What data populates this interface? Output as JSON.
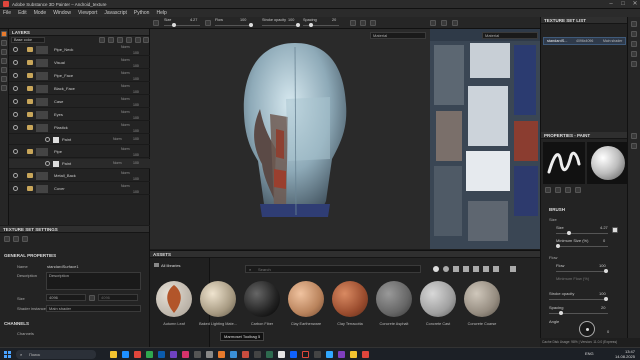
{
  "titlebar": {
    "title": "Adobe Substance 3D Painter – Android_texture",
    "minimize": "–",
    "maximize": "□",
    "close": "✕"
  },
  "menu": [
    "File",
    "Edit",
    "Mode",
    "Window",
    "Viewport",
    "Javascript",
    "Python",
    "Help"
  ],
  "toolbar": {
    "size_label": "Size",
    "size_value": "4.27",
    "flow_label": "Flow",
    "flow_value": "100",
    "stroke_label": "Stroke opacity",
    "stroke_value": "100",
    "spacing_label": "Spacing",
    "spacing_value": "20"
  },
  "layers": {
    "title": "LAYERS",
    "channel": "Base color",
    "rows": [
      {
        "name": "Pipe_Neck",
        "blend": "Norm",
        "opacity": "100"
      },
      {
        "name": "Visual",
        "blend": "Norm",
        "opacity": "100"
      },
      {
        "name": "Pipe_Face",
        "blend": "Norm",
        "opacity": "100"
      },
      {
        "name": "Black_Face",
        "blend": "Norm",
        "opacity": "100"
      },
      {
        "name": "Case",
        "blend": "Norm",
        "opacity": "100"
      },
      {
        "name": "Eyes",
        "blend": "Norm",
        "opacity": "100"
      },
      {
        "name": "Plastick",
        "blend": "Norm",
        "opacity": "100"
      },
      {
        "name": "Paint",
        "blend": "Norm",
        "opacity": "100"
      },
      {
        "name": "Pipe",
        "blend": "Norm",
        "opacity": "100"
      },
      {
        "name": "Paint",
        "blend": "Norm",
        "opacity": "100"
      },
      {
        "name": "Metall_Back",
        "blend": "Norm",
        "opacity": "100"
      },
      {
        "name": "Cover",
        "blend": "Norm",
        "opacity": "100"
      }
    ]
  },
  "texture_set_settings": {
    "title": "TEXTURE SET SETTINGS",
    "general_properties": "GENERAL PROPERTIES",
    "name_label": "Name",
    "name_value": "standardSurface1",
    "description_label": "Description",
    "description_placeholder": "Description",
    "size_label": "Size",
    "size_value": "4096",
    "size_value2": "4096",
    "shader_label": "Shader instance",
    "shader_value": "Main shader",
    "channels": "CHANNELS",
    "channels_sub": "Channels"
  },
  "viewport": {
    "material_select": "Material"
  },
  "uv_view": {
    "material_select": "Material"
  },
  "texture_set_list": {
    "title": "TEXTURE SET LIST",
    "item_name": "standardS...",
    "item_size": "4096x4096",
    "item_shader": "Main shader"
  },
  "properties": {
    "title": "PROPERTIES - PAINT",
    "brush": "BRUSH",
    "size_group": "Size",
    "size_label": "Size",
    "size_value": "4.27",
    "min_size_label": "Minimum Size (%)",
    "min_size_value": "0",
    "flow_group": "Flow",
    "flow_label": "Flow",
    "flow_value": "100",
    "min_flow_label": "Minimum Flow (%)",
    "stroke_label": "Stroke opacity",
    "stroke_value": "100",
    "spacing_label": "Spacing",
    "spacing_value": "20",
    "angle_label": "Angle",
    "angle_value": "0"
  },
  "assets": {
    "title": "ASSETS",
    "library": "All libraries",
    "search_placeholder": "Search",
    "items": [
      {
        "name": "Autumn Leaf"
      },
      {
        "name": "Baked Lighting Mate..."
      },
      {
        "name": "Carbon Fiber"
      },
      {
        "name": "Clay Earthenware"
      },
      {
        "name": "Clay Terracotta"
      },
      {
        "name": "Concrete Asphalt"
      },
      {
        "name": "Concrete Cast"
      },
      {
        "name": "Concrete Coarse"
      }
    ],
    "tooltip": "Marmoset Toolbag 5"
  },
  "statusbar": {
    "text": "Cache Disk Usage: 98% | Version: 11.0.0 (Express)"
  },
  "taskbar": {
    "search": "Поиск",
    "lang": "ENG",
    "time": "13:47",
    "date": "14.08.2025"
  },
  "colors": {
    "accent": "#e87a2c",
    "panel": "#232323",
    "uv_bg": "#2f3a48"
  }
}
